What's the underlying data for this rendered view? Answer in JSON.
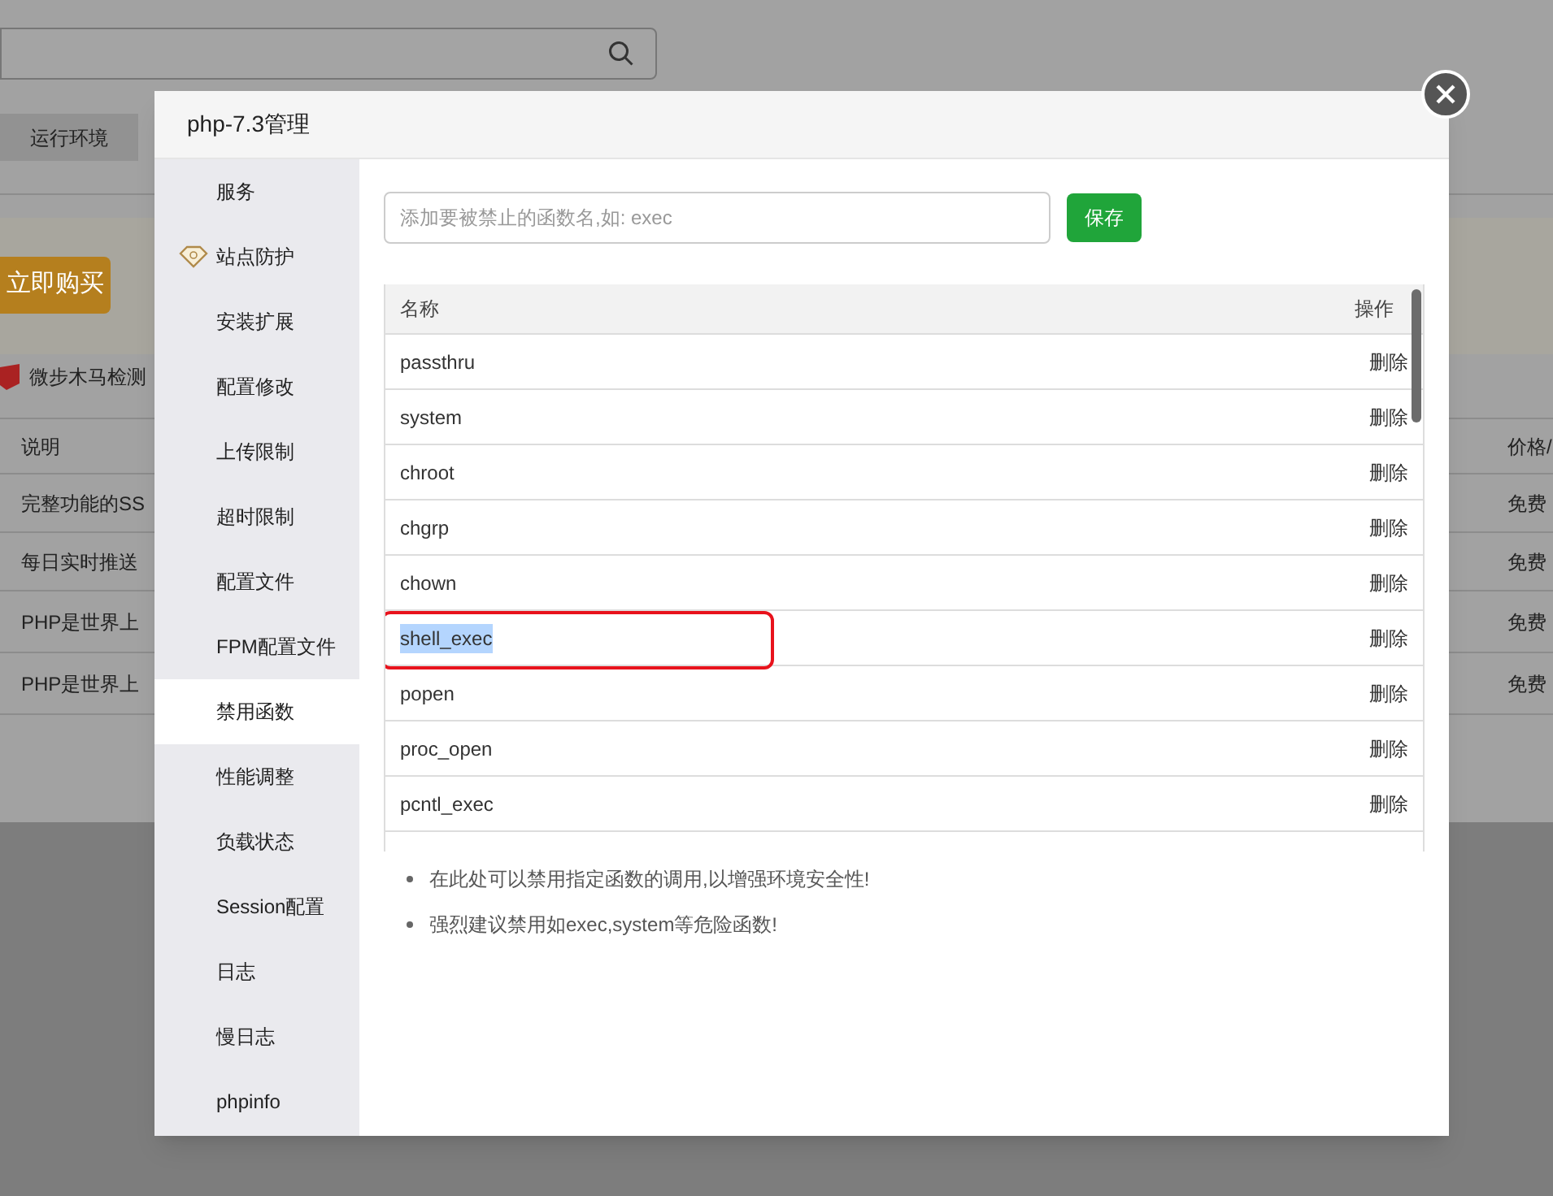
{
  "background": {
    "tab": "运行环境",
    "buy_button": "立即购买",
    "scanner": "微步木马检测",
    "table": {
      "columns": [
        "说明",
        "价格/"
      ],
      "rows": [
        {
          "desc": "完整功能的SS",
          "price": "免费"
        },
        {
          "desc": "每日实时推送",
          "price": "免费"
        },
        {
          "desc": "PHP是世界上",
          "price": "免费"
        },
        {
          "desc": "PHP是世界上",
          "price": "免费"
        }
      ]
    }
  },
  "dialog": {
    "title": "php-7.3管理",
    "sidebar": {
      "items": [
        {
          "label": "服务",
          "selected": false,
          "premium": false
        },
        {
          "label": "站点防护",
          "selected": false,
          "premium": true
        },
        {
          "label": "安装扩展",
          "selected": false,
          "premium": false
        },
        {
          "label": "配置修改",
          "selected": false,
          "premium": false
        },
        {
          "label": "上传限制",
          "selected": false,
          "premium": false
        },
        {
          "label": "超时限制",
          "selected": false,
          "premium": false
        },
        {
          "label": "配置文件",
          "selected": false,
          "premium": false
        },
        {
          "label": "FPM配置文件",
          "selected": false,
          "premium": false
        },
        {
          "label": "禁用函数",
          "selected": true,
          "premium": false
        },
        {
          "label": "性能调整",
          "selected": false,
          "premium": false
        },
        {
          "label": "负载状态",
          "selected": false,
          "premium": false
        },
        {
          "label": "Session配置",
          "selected": false,
          "premium": false
        },
        {
          "label": "日志",
          "selected": false,
          "premium": false
        },
        {
          "label": "慢日志",
          "selected": false,
          "premium": false
        },
        {
          "label": "phpinfo",
          "selected": false,
          "premium": false
        }
      ]
    },
    "function_input": {
      "placeholder": "添加要被禁止的函数名,如: exec"
    },
    "save_button": "保存",
    "table": {
      "columns": [
        "名称",
        "操作"
      ],
      "rows": [
        {
          "name": "passthru",
          "action": "删除",
          "highlighted": false
        },
        {
          "name": "system",
          "action": "删除",
          "highlighted": false
        },
        {
          "name": "chroot",
          "action": "删除",
          "highlighted": false
        },
        {
          "name": "chgrp",
          "action": "删除",
          "highlighted": false
        },
        {
          "name": "chown",
          "action": "删除",
          "highlighted": false
        },
        {
          "name": "shell_exec",
          "action": "删除",
          "highlighted": true
        },
        {
          "name": "popen",
          "action": "删除",
          "highlighted": false
        },
        {
          "name": "proc_open",
          "action": "删除",
          "highlighted": false
        },
        {
          "name": "pcntl_exec",
          "action": "删除",
          "highlighted": false
        }
      ]
    },
    "notes": [
      "在此处可以禁用指定函数的调用,以增强环境安全性!",
      "强烈建议禁用如exec,system等危险函数!"
    ]
  }
}
